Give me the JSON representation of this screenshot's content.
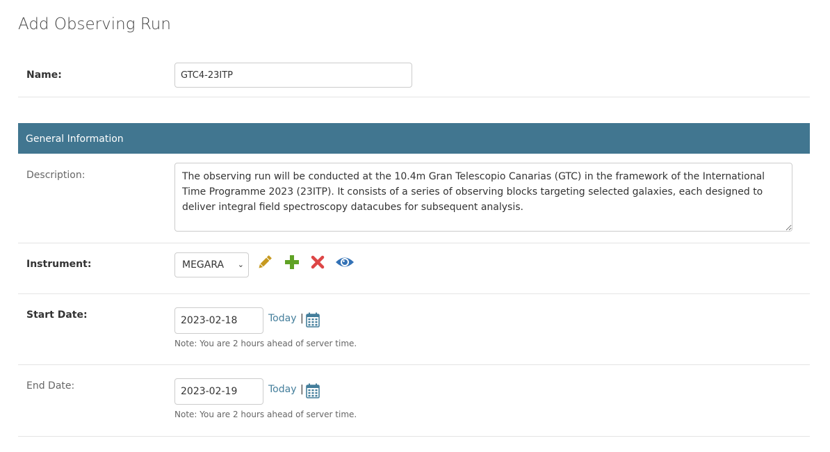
{
  "page": {
    "title": "Add Observing Run"
  },
  "name_field": {
    "label": "Name:",
    "value": "GTC4-23ITP"
  },
  "section": {
    "title": "General Information"
  },
  "description_field": {
    "label": "Description:",
    "value": "The observing run will be conducted at the 10.4m Gran Telescopio Canarias (GTC) in the framework of the International Time Programme 2023 (23ITP). It consists of a series of observing blocks targeting selected galaxies, each designed to deliver integral field spectroscopy datacubes for subsequent analysis."
  },
  "instrument_field": {
    "label": "Instrument:",
    "selected": "MEGARA",
    "actions": {
      "change": "pencil-icon",
      "add": "plus-icon",
      "delete": "x-icon",
      "view": "eye-icon"
    },
    "colors": {
      "change": "#c6991f",
      "add": "#5fa225",
      "delete": "#dd4646",
      "view": "#3372b6"
    }
  },
  "start_date_field": {
    "label": "Start Date:",
    "value": "2023-02-18",
    "today_label": "Today",
    "separator": "|",
    "help": "Note: You are 2 hours ahead of server time."
  },
  "end_date_field": {
    "label": "End Date:",
    "value": "2023-02-19",
    "today_label": "Today",
    "separator": "|",
    "help": "Note: You are 2 hours ahead of server time."
  },
  "theme": {
    "header_bg": "#417690",
    "link": "#447e9b"
  }
}
